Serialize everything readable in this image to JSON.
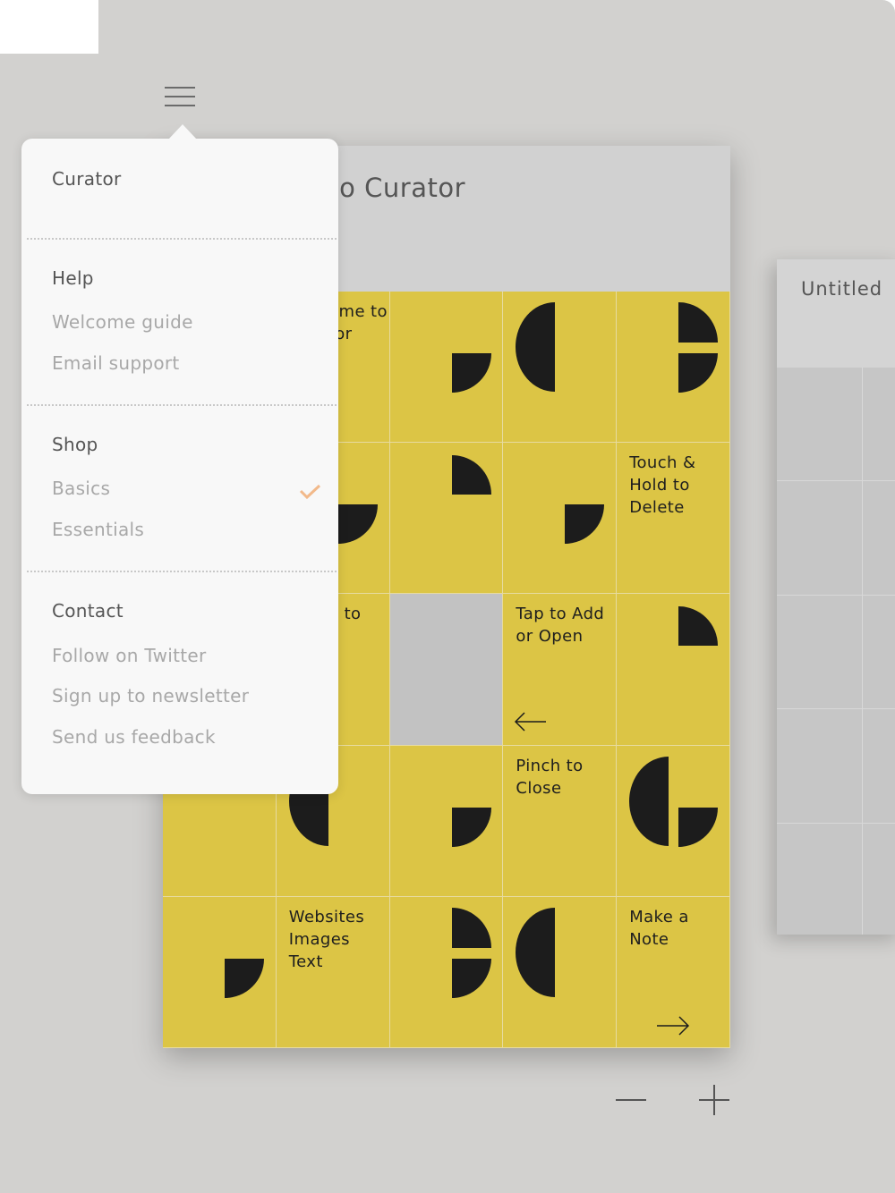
{
  "card": {
    "title": "Welcome to Curator",
    "grid": {
      "columns": 5,
      "rows": 5,
      "accent_color": "#dcc545",
      "cells": [
        {
          "col": 1,
          "row": 0,
          "text": "Welcome to Curator"
        },
        {
          "col": 2,
          "row": 0,
          "shapes": [
            "quarter-low"
          ]
        },
        {
          "col": 3,
          "row": 0,
          "shapes": [
            "half-left"
          ]
        },
        {
          "col": 4,
          "row": 0,
          "shapes": [
            "half-right-split"
          ]
        },
        {
          "col": 1,
          "row": 1,
          "shapes": [
            "quarter-low"
          ]
        },
        {
          "col": 2,
          "row": 1,
          "shapes": [
            "quarter-high"
          ]
        },
        {
          "col": 3,
          "row": 1,
          "shapes": [
            "quarter-low"
          ]
        },
        {
          "col": 4,
          "row": 1,
          "text": "Touch &\nHold to\nDelete"
        },
        {
          "col": 1,
          "row": 2,
          "text": "Swipe to"
        },
        {
          "col": 2,
          "row": 2,
          "empty": true
        },
        {
          "col": 3,
          "row": 2,
          "text": "Tap to Add\nor Open",
          "icon": "arrow-left"
        },
        {
          "col": 4,
          "row": 2,
          "shapes": [
            "quarter-high"
          ]
        },
        {
          "col": 1,
          "row": 3,
          "shapes": [
            "half-left"
          ]
        },
        {
          "col": 2,
          "row": 3,
          "shapes": [
            "quarter-low"
          ]
        },
        {
          "col": 3,
          "row": 3,
          "text": "Pinch to\nClose"
        },
        {
          "col": 4,
          "row": 3,
          "shapes": [
            "half-left",
            "quarter-low"
          ]
        },
        {
          "col": 0,
          "row": 4,
          "shapes": [
            "quarter-low"
          ]
        },
        {
          "col": 1,
          "row": 4,
          "text": "Websites\nImages\nText"
        },
        {
          "col": 2,
          "row": 4,
          "shapes": [
            "half-right-split"
          ]
        },
        {
          "col": 3,
          "row": 4,
          "shapes": [
            "half-left"
          ]
        },
        {
          "col": 4,
          "row": 4,
          "text": "Make a\nNote",
          "icon": "arrow-right"
        }
      ]
    }
  },
  "side_board": {
    "title": "Untitled"
  },
  "menu": {
    "sections": [
      {
        "heading": "Curator",
        "items": []
      },
      {
        "heading": "Help",
        "items": [
          "Welcome guide",
          "Email support"
        ]
      },
      {
        "heading": "Shop",
        "items": [
          "Basics",
          "Essentials"
        ],
        "selected": "Basics"
      },
      {
        "heading": "Contact",
        "items": [
          "Follow on Twitter",
          "Sign up to newsletter",
          "Send us feedback"
        ]
      }
    ],
    "check_color": "#f2b98a"
  },
  "zoom_controls": {
    "out": "minus-icon",
    "in": "plus-icon"
  }
}
